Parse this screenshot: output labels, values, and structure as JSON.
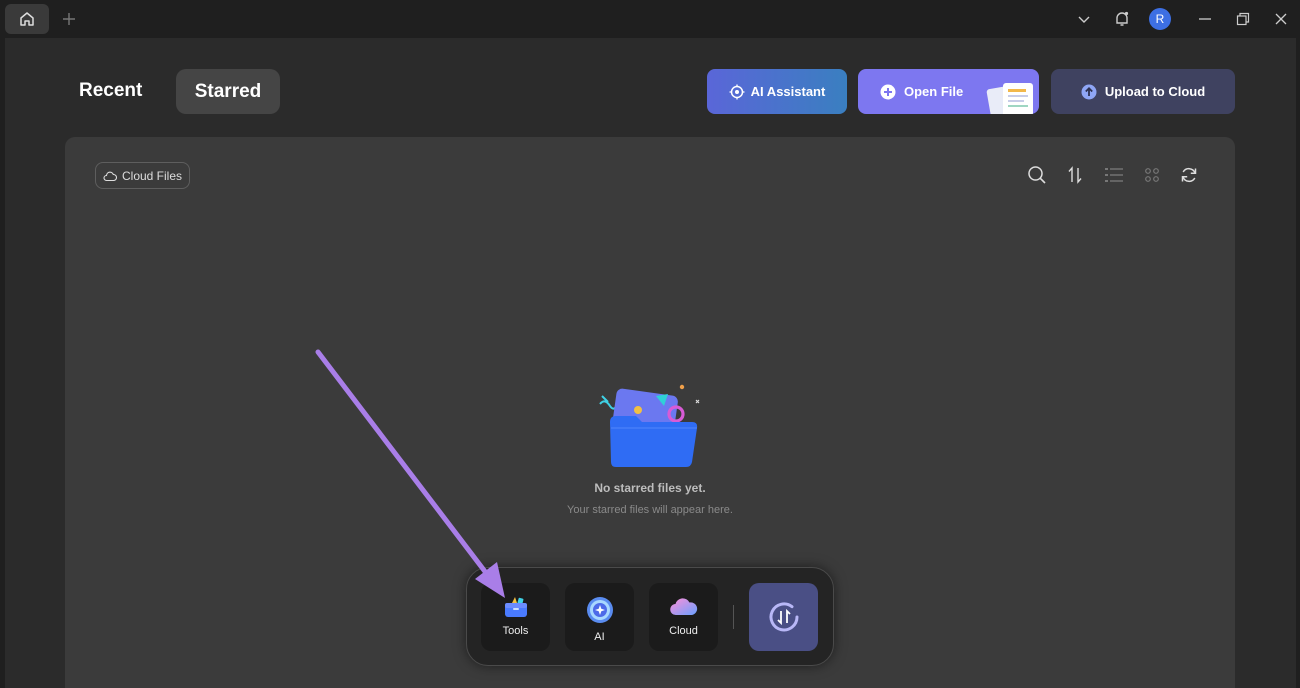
{
  "titlebar": {
    "avatar_letter": "R",
    "icons": [
      "home-icon",
      "plus-icon",
      "chevron-down-icon",
      "bell-icon",
      "minimize-icon",
      "restore-icon",
      "close-icon"
    ]
  },
  "tabs": {
    "recent": "Recent",
    "starred": "Starred"
  },
  "actions": {
    "ai_assistant": "AI Assistant",
    "open_file": "Open File",
    "upload_to_cloud": "Upload to Cloud"
  },
  "panel": {
    "cloud_files_label": "Cloud Files",
    "toolbar_icons": [
      "search-icon",
      "sort-icon",
      "list-view-icon",
      "grid-view-icon",
      "refresh-icon"
    ]
  },
  "empty_state": {
    "title": "No starred files yet.",
    "subtitle": "Your starred files will appear here."
  },
  "dock": {
    "items": [
      {
        "label": "Tools",
        "icon": "toolbox-icon"
      },
      {
        "label": "AI",
        "icon": "ai-orb-icon"
      },
      {
        "label": "Cloud",
        "icon": "cloud-icon"
      }
    ],
    "convert_icon": "convert-icon"
  },
  "colors": {
    "accent": "#7d77f0",
    "annotation_arrow": "#a97ee8"
  }
}
